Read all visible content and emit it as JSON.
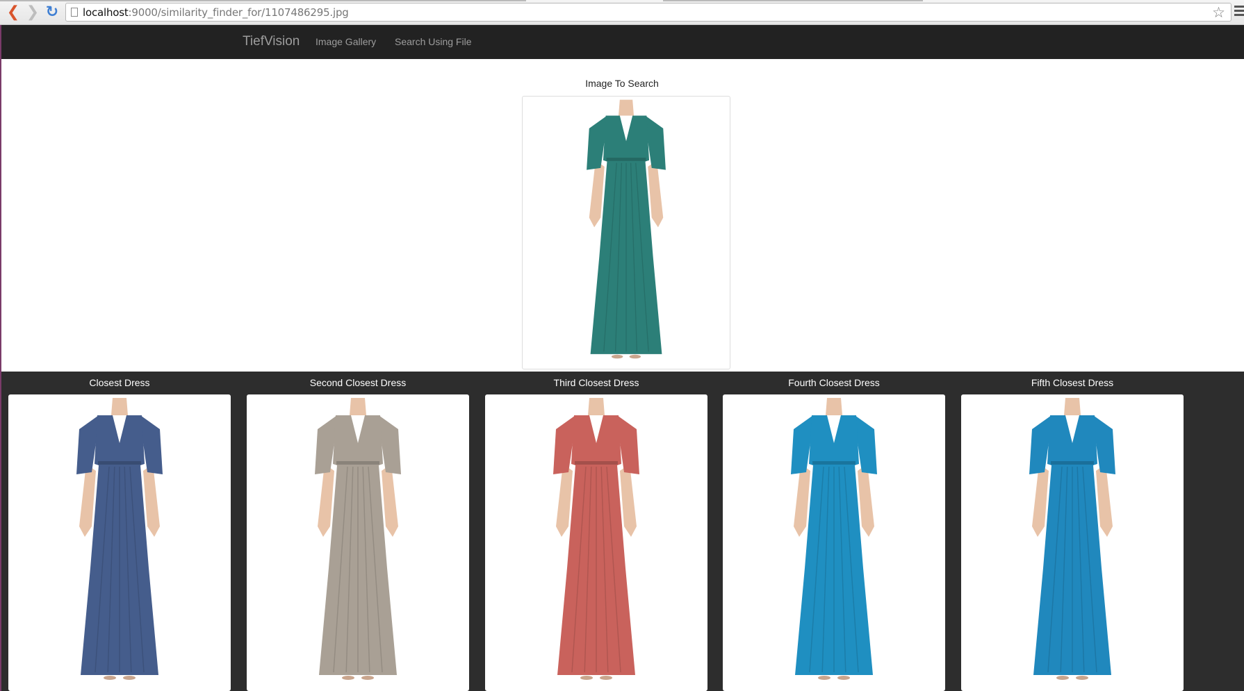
{
  "browser": {
    "url_host": "localhost",
    "url_path": ":9000/similarity_finder_for/1107486295.jpg",
    "back_icon": "back-arrow-icon",
    "forward_icon": "forward-arrow-icon",
    "reload_icon": "reload-icon",
    "star_icon": "bookmark-star-icon",
    "menu_icon": "hamburger-menu-icon"
  },
  "navbar": {
    "brand": "TiefVision",
    "links": [
      {
        "label": "Image Gallery"
      },
      {
        "label": "Search Using File"
      }
    ]
  },
  "search": {
    "title": "Image To Search",
    "dress_color": "#2c7f78"
  },
  "results": [
    {
      "label": "Closest Dress",
      "color": "#455d8c"
    },
    {
      "label": "Second Closest Dress",
      "color": "#a9a095"
    },
    {
      "label": "Third Closest Dress",
      "color": "#c9625c"
    },
    {
      "label": "Fourth Closest Dress",
      "color": "#1f8fc1"
    },
    {
      "label": "Fifth Closest Dress",
      "color": "#2088bd"
    }
  ]
}
